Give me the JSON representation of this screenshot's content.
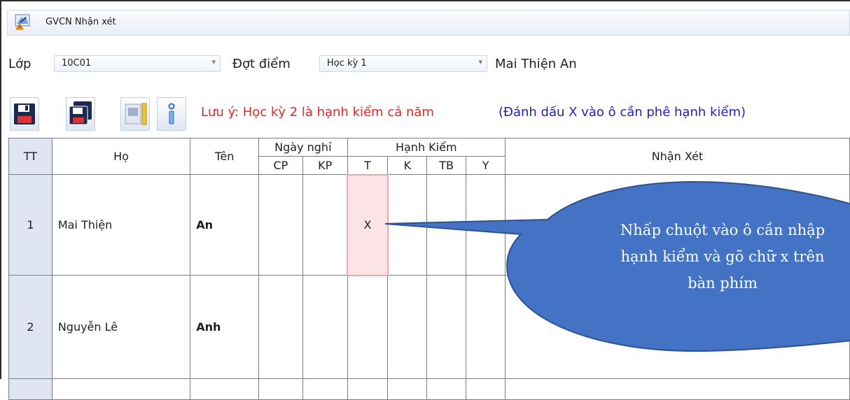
{
  "window": {
    "title": "GVCN Nhận xét"
  },
  "filters": {
    "class_label": "Lớp",
    "class_value": "10C01",
    "period_label": "Đợt điểm",
    "period_value": "Học kỳ 1",
    "student_name": "Mai Thiện An"
  },
  "toolbar": {
    "note_red": "Lưu ý: Học kỳ 2 là hạnh kiểm cả năm",
    "note_blue": "(Đánh dấu X vào ô cần phê hạnh kiểm)"
  },
  "table": {
    "headers": {
      "tt": "TT",
      "ho": "Họ",
      "ten": "Tên",
      "ngay_nghi": "Ngày nghỉ",
      "cp": "CP",
      "kp": "KP",
      "hanh_kiem": "Hạnh Kiểm",
      "t": "T",
      "k": "K",
      "tb": "TB",
      "y": "Y",
      "nhan_xet": "Nhận Xét"
    },
    "rows": [
      {
        "tt": "1",
        "ho": "Mai Thiện",
        "ten": "An",
        "cp": "",
        "kp": "",
        "t": "X",
        "k": "",
        "tb": "",
        "y": "",
        "nhan_xet": ""
      },
      {
        "tt": "2",
        "ho": "Nguyễn Lê",
        "ten": "Anh",
        "cp": "",
        "kp": "",
        "t": "",
        "k": "",
        "tb": "",
        "y": "",
        "nhan_xet": ""
      }
    ]
  },
  "callout": {
    "line1": "Nhấp chuột vào ô cần nhập",
    "line2": "hạnh kiểm và gõ chữ x trên",
    "line3": "bàn phím",
    "color": "#4472c4"
  }
}
